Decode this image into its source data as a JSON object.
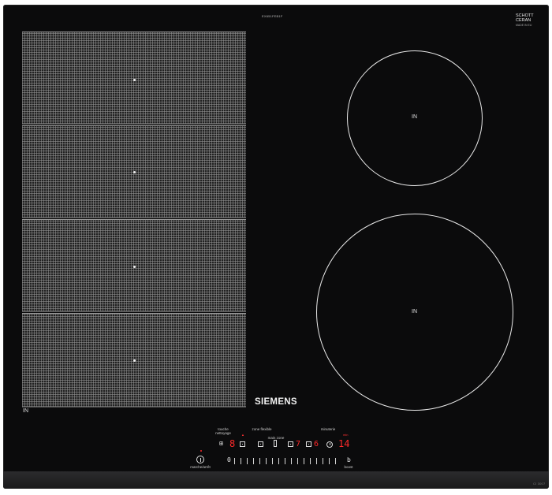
{
  "top": {
    "model_code": "EX651FEB1F",
    "maker": "SCHOTT",
    "glass": "CERAN",
    "glass_sub": "MADE IN EU"
  },
  "zones": {
    "flex_label": "IN",
    "round_small_label": "IN",
    "round_large_label": "IN"
  },
  "brand": "SIEMENS",
  "controls": {
    "touche_nettoyage": "touche\nnettoyage",
    "zone_flexible": "zone flexible",
    "main_zone": "main zone",
    "minuterie": "minuterie",
    "marche_arret": "marche/arrêt",
    "boost": "boost",
    "boost_key": "b",
    "zero_key": "0",
    "red_small_top": "▲",
    "digits": {
      "zone_flex_level": "8",
      "zone_a_level": "7",
      "zone_b_level": "6",
      "timer": "14",
      "timer_indicator": "min"
    }
  },
  "bottom_mark": "CI 3007"
}
